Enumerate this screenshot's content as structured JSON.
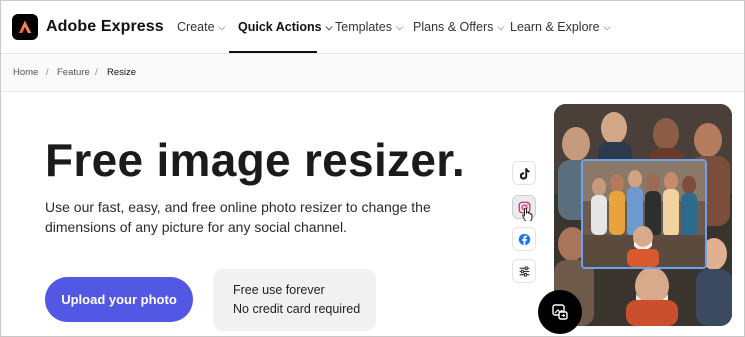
{
  "brand": {
    "name": "Adobe Express"
  },
  "nav": {
    "items": [
      {
        "label": "Create",
        "chevron": "⌵"
      },
      {
        "label": "Quick Actions",
        "chevron": "⌵"
      },
      {
        "label": "Templates",
        "chevron": "⌵"
      },
      {
        "label": "Plans & Offers",
        "chevron": "⌵"
      },
      {
        "label": "Learn & Explore",
        "chevron": "⌵"
      }
    ],
    "active_item": "Quick Actions"
  },
  "breadcrumb": {
    "items": [
      "Home",
      "Feature",
      "Resize"
    ],
    "separator": "/"
  },
  "hero": {
    "title": "Free image resizer.",
    "description": "Use our fast, easy, and free online photo resizer to change the dimensions of any picture for any social channel.",
    "cta_label": "Upload your photo",
    "info_lines": [
      "Free use forever",
      "No credit card required"
    ]
  },
  "social_channels": [
    {
      "name": "tiktok-icon",
      "selected": false
    },
    {
      "name": "instagram-icon",
      "selected": true
    },
    {
      "name": "facebook-icon",
      "selected": false
    },
    {
      "name": "sliders-icon",
      "selected": false
    }
  ],
  "colors": {
    "accent": "#5258e4",
    "crop_frame": "#6ea0f0",
    "logo_bg": "#000000",
    "info_card_bg": "#f1f1f1"
  }
}
